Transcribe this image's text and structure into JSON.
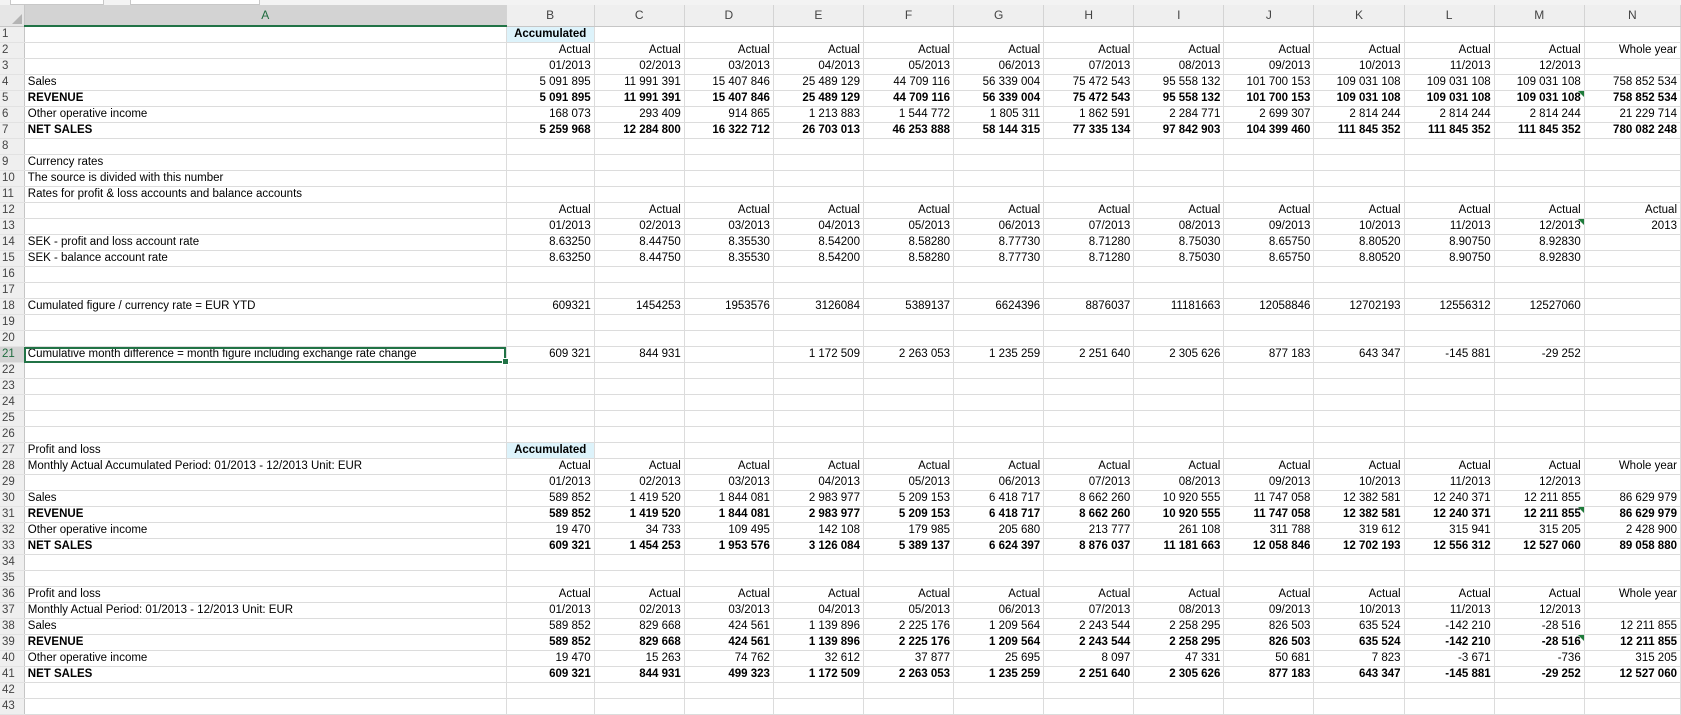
{
  "columns": [
    "A",
    "B",
    "C",
    "D",
    "E",
    "F",
    "G",
    "H",
    "I",
    "J",
    "K",
    "L",
    "M",
    "N"
  ],
  "selected_column": "A",
  "selected_row": 21,
  "active_cell": "A21",
  "accent_color": "#217346",
  "highlight_color": "#ddf3fb",
  "rows": [
    {
      "n": 1,
      "a": "",
      "cells": [
        "Accumulated",
        "",
        "",
        "",
        "",
        "",
        "",
        "",
        "",
        "",
        "",
        "",
        ""
      ],
      "acc": true
    },
    {
      "n": 2,
      "a": "",
      "cells": [
        "Actual",
        "Actual",
        "Actual",
        "Actual",
        "Actual",
        "Actual",
        "Actual",
        "Actual",
        "Actual",
        "Actual",
        "Actual",
        "Actual",
        "Whole year"
      ]
    },
    {
      "n": 3,
      "a": "",
      "cells": [
        "01/2013",
        "02/2013",
        "03/2013",
        "04/2013",
        "05/2013",
        "06/2013",
        "07/2013",
        "08/2013",
        "09/2013",
        "10/2013",
        "11/2013",
        "12/2013",
        ""
      ]
    },
    {
      "n": 4,
      "a": "Sales",
      "cells": [
        "5 091 895",
        "11 991 391",
        "15 407 846",
        "25 489 129",
        "44 709 116",
        "56 339 004",
        "75 472 543",
        "95 558 132",
        "101 700 153",
        "109 031 108",
        "109 031 108",
        "109 031 108",
        "758 852 534"
      ]
    },
    {
      "n": 5,
      "a": "REVENUE",
      "bold": true,
      "flagM": true,
      "cells": [
        "5 091 895",
        "11 991 391",
        "15 407 846",
        "25 489 129",
        "44 709 116",
        "56 339 004",
        "75 472 543",
        "95 558 132",
        "101 700 153",
        "109 031 108",
        "109 031 108",
        "109 031 108",
        "758 852 534"
      ]
    },
    {
      "n": 6,
      "a": "Other operative income",
      "cells": [
        "168 073",
        "293 409",
        "914 865",
        "1 213 883",
        "1 544 772",
        "1 805 311",
        "1 862 591",
        "2 284 771",
        "2 699 307",
        "2 814 244",
        "2 814 244",
        "2 814 244",
        "21 229 714"
      ]
    },
    {
      "n": 7,
      "a": "NET SALES",
      "bold": true,
      "cells": [
        "5 259 968",
        "12 284 800",
        "16 322 712",
        "26 703 013",
        "46 253 888",
        "58 144 315",
        "77 335 134",
        "97 842 903",
        "104 399 460",
        "111 845 352",
        "111 845 352",
        "111 845 352",
        "780 082 248"
      ]
    },
    {
      "n": 8,
      "a": "",
      "cells": [
        "",
        "",
        "",
        "",
        "",
        "",
        "",
        "",
        "",
        "",
        "",
        "",
        ""
      ]
    },
    {
      "n": 9,
      "a": "Currency rates",
      "cells": [
        "",
        "",
        "",
        "",
        "",
        "",
        "",
        "",
        "",
        "",
        "",
        "",
        ""
      ]
    },
    {
      "n": 10,
      "a": "The source is divided with this number",
      "cells": [
        "",
        "",
        "",
        "",
        "",
        "",
        "",
        "",
        "",
        "",
        "",
        "",
        ""
      ]
    },
    {
      "n": 11,
      "a": "Rates for profit & loss accounts and balance accounts",
      "cells": [
        "",
        "",
        "",
        "",
        "",
        "",
        "",
        "",
        "",
        "",
        "",
        "",
        ""
      ]
    },
    {
      "n": 12,
      "a": "",
      "cells": [
        "Actual",
        "Actual",
        "Actual",
        "Actual",
        "Actual",
        "Actual",
        "Actual",
        "Actual",
        "Actual",
        "Actual",
        "Actual",
        "Actual",
        "Actual"
      ]
    },
    {
      "n": 13,
      "a": "",
      "flagM": true,
      "cells": [
        "01/2013",
        "02/2013",
        "03/2013",
        "04/2013",
        "05/2013",
        "06/2013",
        "07/2013",
        "08/2013",
        "09/2013",
        "10/2013",
        "11/2013",
        "12/2013",
        "2013"
      ]
    },
    {
      "n": 14,
      "a": "SEK - profit and loss account rate",
      "cells": [
        "8.63250",
        "8.44750",
        "8.35530",
        "8.54200",
        "8.58280",
        "8.77730",
        "8.71280",
        "8.75030",
        "8.65750",
        "8.80520",
        "8.90750",
        "8.92830",
        ""
      ]
    },
    {
      "n": 15,
      "a": "SEK - balance account rate",
      "cells": [
        "8.63250",
        "8.44750",
        "8.35530",
        "8.54200",
        "8.58280",
        "8.77730",
        "8.71280",
        "8.75030",
        "8.65750",
        "8.80520",
        "8.90750",
        "8.92830",
        ""
      ]
    },
    {
      "n": 16,
      "a": "",
      "cells": [
        "",
        "",
        "",
        "",
        "",
        "",
        "",
        "",
        "",
        "",
        "",
        "",
        ""
      ]
    },
    {
      "n": 17,
      "a": "",
      "cells": [
        "",
        "",
        "",
        "",
        "",
        "",
        "",
        "",
        "",
        "",
        "",
        "",
        ""
      ]
    },
    {
      "n": 18,
      "a": "Cumulated figure / currency rate = EUR YTD",
      "cells": [
        "609321",
        "1454253",
        "1953576",
        "3126084",
        "5389137",
        "6624396",
        "8876037",
        "11181663",
        "12058846",
        "12702193",
        "12556312",
        "12527060",
        ""
      ]
    },
    {
      "n": 19,
      "a": "",
      "cells": [
        "",
        "",
        "",
        "",
        "",
        "",
        "",
        "",
        "",
        "",
        "",
        "",
        ""
      ]
    },
    {
      "n": 20,
      "a": "",
      "cells": [
        "",
        "",
        "",
        "",
        "",
        "",
        "",
        "",
        "",
        "",
        "",
        "",
        ""
      ]
    },
    {
      "n": 21,
      "a": "Cumulative month difference = month figure including exchange rate change",
      "active": true,
      "cells": [
        "609 321",
        "844 931",
        "",
        "1 172 509",
        "2 263 053",
        "1 235 259",
        "2 251 640",
        "2 305 626",
        "877 183",
        "643 347",
        "-145 881",
        "-29 252",
        ""
      ]
    },
    {
      "n": 22,
      "a": "",
      "cells": [
        "",
        "",
        "",
        "",
        "",
        "",
        "",
        "",
        "",
        "",
        "",
        "",
        ""
      ]
    },
    {
      "n": 23,
      "a": "",
      "cells": [
        "",
        "",
        "",
        "",
        "",
        "",
        "",
        "",
        "",
        "",
        "",
        "",
        ""
      ]
    },
    {
      "n": 24,
      "a": "",
      "cells": [
        "",
        "",
        "",
        "",
        "",
        "",
        "",
        "",
        "",
        "",
        "",
        "",
        ""
      ]
    },
    {
      "n": 25,
      "a": "",
      "cells": [
        "",
        "",
        "",
        "",
        "",
        "",
        "",
        "",
        "",
        "",
        "",
        "",
        ""
      ]
    },
    {
      "n": 26,
      "a": "",
      "cells": [
        "",
        "",
        "",
        "",
        "",
        "",
        "",
        "",
        "",
        "",
        "",
        "",
        ""
      ]
    },
    {
      "n": 27,
      "a": "Profit and loss",
      "cells": [
        "Accumulated",
        "",
        "",
        "",
        "",
        "",
        "",
        "",
        "",
        "",
        "",
        "",
        ""
      ],
      "acc": true
    },
    {
      "n": 28,
      "a": "Monthly Actual Accumulated Period: 01/2013 - 12/2013 Unit: EUR",
      "cells": [
        "Actual",
        "Actual",
        "Actual",
        "Actual",
        "Actual",
        "Actual",
        "Actual",
        "Actual",
        "Actual",
        "Actual",
        "Actual",
        "Actual",
        "Whole year"
      ]
    },
    {
      "n": 29,
      "a": "",
      "cells": [
        "01/2013",
        "02/2013",
        "03/2013",
        "04/2013",
        "05/2013",
        "06/2013",
        "07/2013",
        "08/2013",
        "09/2013",
        "10/2013",
        "11/2013",
        "12/2013",
        ""
      ]
    },
    {
      "n": 30,
      "a": "Sales",
      "cells": [
        "589 852",
        "1 419 520",
        "1 844 081",
        "2 983 977",
        "5 209 153",
        "6 418 717",
        "8 662 260",
        "10 920 555",
        "11 747 058",
        "12 382 581",
        "12 240 371",
        "12 211 855",
        "86 629 979"
      ]
    },
    {
      "n": 31,
      "a": "REVENUE",
      "bold": true,
      "flagM": true,
      "cells": [
        "589 852",
        "1 419 520",
        "1 844 081",
        "2 983 977",
        "5 209 153",
        "6 418 717",
        "8 662 260",
        "10 920 555",
        "11 747 058",
        "12 382 581",
        "12 240 371",
        "12 211 855",
        "86 629 979"
      ]
    },
    {
      "n": 32,
      "a": "Other operative income",
      "cells": [
        "19 470",
        "34 733",
        "109 495",
        "142 108",
        "179 985",
        "205 680",
        "213 777",
        "261 108",
        "311 788",
        "319 612",
        "315 941",
        "315 205",
        "2 428 900"
      ]
    },
    {
      "n": 33,
      "a": "NET SALES",
      "bold": true,
      "cells": [
        "609 321",
        "1 454 253",
        "1 953 576",
        "3 126 084",
        "5 389 137",
        "6 624 397",
        "8 876 037",
        "11 181 663",
        "12 058 846",
        "12 702 193",
        "12 556 312",
        "12 527 060",
        "89 058 880"
      ]
    },
    {
      "n": 34,
      "a": "",
      "cells": [
        "",
        "",
        "",
        "",
        "",
        "",
        "",
        "",
        "",
        "",
        "",
        "",
        ""
      ]
    },
    {
      "n": 35,
      "a": "",
      "cells": [
        "",
        "",
        "",
        "",
        "",
        "",
        "",
        "",
        "",
        "",
        "",
        "",
        ""
      ]
    },
    {
      "n": 36,
      "a": "Profit and loss",
      "cells": [
        "Actual",
        "Actual",
        "Actual",
        "Actual",
        "Actual",
        "Actual",
        "Actual",
        "Actual",
        "Actual",
        "Actual",
        "Actual",
        "Actual",
        "Whole year"
      ]
    },
    {
      "n": 37,
      "a": "Monthly Actual Period: 01/2013 - 12/2013 Unit: EUR",
      "cells": [
        "01/2013",
        "02/2013",
        "03/2013",
        "04/2013",
        "05/2013",
        "06/2013",
        "07/2013",
        "08/2013",
        "09/2013",
        "10/2013",
        "11/2013",
        "12/2013",
        ""
      ]
    },
    {
      "n": 38,
      "a": "Sales",
      "cells": [
        "589 852",
        "829 668",
        "424 561",
        "1 139 896",
        "2 225 176",
        "1 209 564",
        "2 243 544",
        "2 258 295",
        "826 503",
        "635 524",
        "-142 210",
        "-28 516",
        "12 211 855"
      ]
    },
    {
      "n": 39,
      "a": "REVENUE",
      "bold": true,
      "flagM": true,
      "cells": [
        "589 852",
        "829 668",
        "424 561",
        "1 139 896",
        "2 225 176",
        "1 209 564",
        "2 243 544",
        "2 258 295",
        "826 503",
        "635 524",
        "-142 210",
        "-28 516",
        "12 211 855"
      ]
    },
    {
      "n": 40,
      "a": "Other operative income",
      "cells": [
        "19 470",
        "15 263",
        "74 762",
        "32 612",
        "37 877",
        "25 695",
        "8 097",
        "47 331",
        "50 681",
        "7 823",
        "-3 671",
        "-736",
        "315 205"
      ]
    },
    {
      "n": 41,
      "a": "NET SALES",
      "bold": true,
      "cells": [
        "609 321",
        "844 931",
        "499 323",
        "1 172 509",
        "2 263 053",
        "1 235 259",
        "2 251 640",
        "2 305 626",
        "877 183",
        "643 347",
        "-145 881",
        "-29 252",
        "12 527 060"
      ]
    },
    {
      "n": 42,
      "a": "",
      "cells": [
        "",
        "",
        "",
        "",
        "",
        "",
        "",
        "",
        "",
        "",
        "",
        "",
        ""
      ]
    },
    {
      "n": 43,
      "a": "",
      "cells": [
        "",
        "",
        "",
        "",
        "",
        "",
        "",
        "",
        "",
        "",
        "",
        "",
        ""
      ]
    }
  ]
}
